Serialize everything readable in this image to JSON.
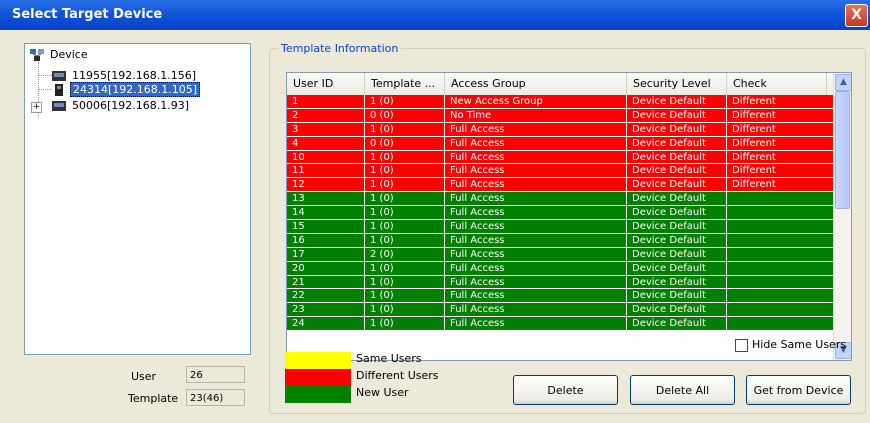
{
  "window": {
    "title": "Select Target Device",
    "close_label": "X"
  },
  "tree": {
    "root_label": "Device",
    "nodes": [
      {
        "label": "11955[192.168.1.156]",
        "selected": false,
        "expandable": false
      },
      {
        "label": "24314[192.168.1.105]",
        "selected": true,
        "expandable": false
      },
      {
        "label": "50006[192.168.1.93]",
        "selected": false,
        "expandable": true,
        "expander": "+"
      }
    ]
  },
  "stats": {
    "user_label": "User",
    "user_value": "26",
    "template_label": "Template",
    "template_value": "23(46)"
  },
  "template_info": {
    "group_title": "Template Information",
    "columns": [
      "User ID",
      "Template ...",
      "Access Group",
      "Security Level",
      "Check"
    ],
    "rows": [
      [
        "1",
        "1 (0)",
        "New Access Group",
        "Device Default",
        "Different"
      ],
      [
        "2",
        "0 (0)",
        "No Time",
        "Device Default",
        "Different"
      ],
      [
        "3",
        "1 (0)",
        "Full Access",
        "Device Default",
        "Different"
      ],
      [
        "4",
        "0 (0)",
        "Full Access",
        "Device Default",
        "Different"
      ],
      [
        "10",
        "1 (0)",
        "Full Access",
        "Device Default",
        "Different"
      ],
      [
        "11",
        "1 (0)",
        "Full Access",
        "Device Default",
        "Different"
      ],
      [
        "12",
        "1 (0)",
        "Full Access",
        "Device Default",
        "Different"
      ],
      [
        "13",
        "1 (0)",
        "Full Access",
        "Device Default",
        ""
      ],
      [
        "14",
        "1 (0)",
        "Full Access",
        "Device Default",
        ""
      ],
      [
        "15",
        "1 (0)",
        "Full Access",
        "Device Default",
        ""
      ],
      [
        "16",
        "1 (0)",
        "Full Access",
        "Device Default",
        ""
      ],
      [
        "17",
        "2 (0)",
        "Full Access",
        "Device Default",
        ""
      ],
      [
        "20",
        "1 (0)",
        "Full Access",
        "Device Default",
        ""
      ],
      [
        "21",
        "1 (0)",
        "Full Access",
        "Device Default",
        ""
      ],
      [
        "22",
        "1 (0)",
        "Full Access",
        "Device Default",
        ""
      ],
      [
        "23",
        "1 (0)",
        "Full Access",
        "Device Default",
        ""
      ],
      [
        "24",
        "1 (0)",
        "Full Access",
        "Device Default",
        ""
      ]
    ],
    "row_status": [
      "different",
      "different",
      "different",
      "different",
      "different",
      "different",
      "different",
      "same",
      "same",
      "same",
      "same",
      "same",
      "same",
      "same",
      "same",
      "same",
      "same"
    ],
    "scroll_up_icon": "▲",
    "scroll_down_icon": "▼"
  },
  "hide_same_users_label": "Hide Same Users",
  "hide_same_users_checked": false,
  "legend": [
    {
      "label": "Same Users",
      "color": "#ffff00"
    },
    {
      "label": "Different Users",
      "color": "#ff0000"
    },
    {
      "label": "New User",
      "color": "#008000"
    }
  ],
  "colors": {
    "different_row": "#ff0000",
    "same_row": "#008000",
    "title_bar": "#0a4fd6",
    "group_title": "#0046d5"
  },
  "buttons": {
    "delete": "Delete",
    "delete_all": "Delete All",
    "get_from_device": "Get from Device"
  }
}
